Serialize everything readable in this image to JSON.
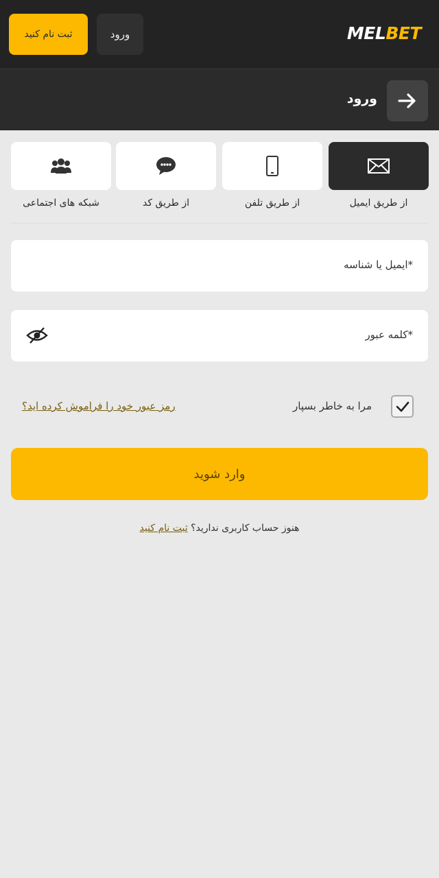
{
  "header": {
    "register_label": "ثبت نام کنید",
    "login_label": "ورود",
    "logo_part1": "MEL",
    "logo_part2": "BET"
  },
  "subheader": {
    "title": "ورود",
    "back_icon": "arrow-right-icon"
  },
  "tabs": [
    {
      "label": "از طریق ایمیل",
      "icon": "envelope-icon",
      "active": true
    },
    {
      "label": "از طریق تلفن",
      "icon": "phone-icon",
      "active": false
    },
    {
      "label": "از طریق کد",
      "icon": "chat-icon",
      "active": false
    },
    {
      "label": "شبکه های اجتماعی",
      "icon": "users-icon",
      "active": false
    }
  ],
  "form": {
    "email_label": "ایمیل یا شناسه*",
    "password_label": "کلمه عبور*",
    "remember_label": "مرا به خاطر بسپار",
    "remember_checked": true,
    "forgot_label": "رمز عبور خود را فراموش کرده اید؟",
    "submit_label": "وارد شوید"
  },
  "footer": {
    "no_account_text": "هنوز حساب کاربری ندارید؟",
    "register_link": "ثبت نام کنید"
  },
  "colors": {
    "accent": "#fcb900",
    "header_bg": "#232323",
    "page_bg": "#e9e9e9"
  }
}
